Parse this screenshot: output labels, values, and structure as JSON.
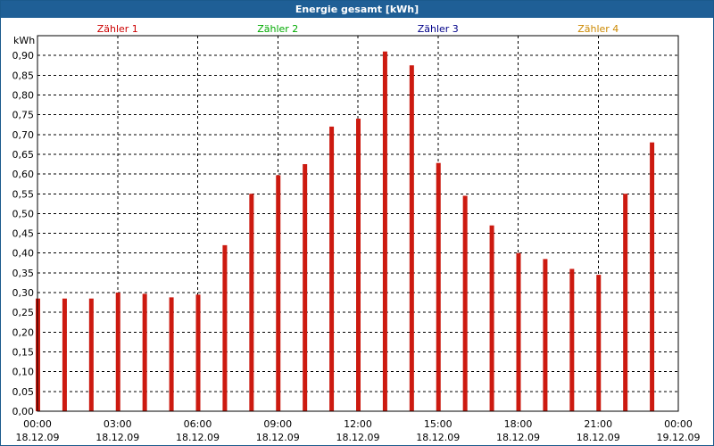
{
  "window": {
    "title": "Energie gesamt [kWh]"
  },
  "chart_data": {
    "type": "bar",
    "title": "Energie gesamt [kWh]",
    "ylabel": "kWh",
    "xlabel": "",
    "ylim": [
      0,
      0.95
    ],
    "y_ticks": [
      "0,00",
      "0,05",
      "0,10",
      "0,15",
      "0,20",
      "0,25",
      "0,30",
      "0,35",
      "0,40",
      "0,45",
      "0,50",
      "0,55",
      "0,60",
      "0,65",
      "0,70",
      "0,75",
      "0,80",
      "0,85",
      "0,90"
    ],
    "x_range_hours": [
      0,
      24
    ],
    "x_ticks": [
      {
        "hour": 0,
        "time": "00:00",
        "date": "18.12.09"
      },
      {
        "hour": 3,
        "time": "03:00",
        "date": "18.12.09"
      },
      {
        "hour": 6,
        "time": "06:00",
        "date": "18.12.09"
      },
      {
        "hour": 9,
        "time": "09:00",
        "date": "18.12.09"
      },
      {
        "hour": 12,
        "time": "12:00",
        "date": "18.12.09"
      },
      {
        "hour": 15,
        "time": "15:00",
        "date": "18.12.09"
      },
      {
        "hour": 18,
        "time": "18:00",
        "date": "18.12.09"
      },
      {
        "hour": 21,
        "time": "21:00",
        "date": "18.12.09"
      },
      {
        "hour": 24,
        "time": "00:00",
        "date": "19.12.09"
      }
    ],
    "legend": [
      {
        "label": "Zähler 1",
        "color": "#cc0000"
      },
      {
        "label": "Zähler 2",
        "color": "#00aa00"
      },
      {
        "label": "Zähler 3",
        "color": "#000088"
      },
      {
        "label": "Zähler 4",
        "color": "#cc8800"
      }
    ],
    "grid": true,
    "series": [
      {
        "color": "#cc1a10",
        "x": [
          0,
          1,
          2,
          3,
          4,
          5,
          6,
          7,
          8,
          9,
          10,
          11,
          12,
          13,
          14,
          15,
          16,
          17,
          18,
          19,
          20,
          21,
          22,
          23
        ],
        "values": [
          0.285,
          0.285,
          0.285,
          0.3,
          0.297,
          0.288,
          0.295,
          0.42,
          0.55,
          0.597,
          0.625,
          0.72,
          0.74,
          0.91,
          0.875,
          0.628,
          0.545,
          0.47,
          0.4,
          0.385,
          0.36,
          0.345,
          0.55,
          0.68
        ]
      }
    ]
  }
}
